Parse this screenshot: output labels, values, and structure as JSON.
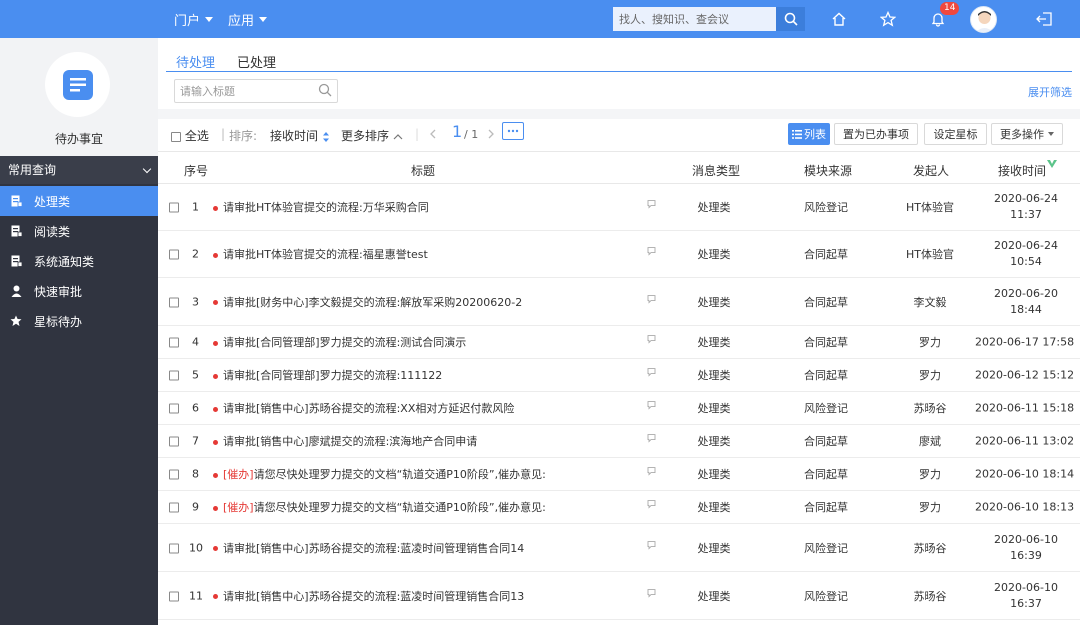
{
  "topbar": {
    "nav": [
      {
        "label": "门户"
      },
      {
        "label": "应用"
      }
    ],
    "search_placeholder": "找人、搜知识、查会议",
    "notification_count": "14"
  },
  "sidebar": {
    "title": "待办事宜",
    "group_label": "常用查询",
    "items": [
      {
        "label": "处理类",
        "icon": "document-icon",
        "active": true
      },
      {
        "label": "阅读类",
        "icon": "read-icon",
        "active": false
      },
      {
        "label": "系统通知类",
        "icon": "notice-icon",
        "active": false
      },
      {
        "label": "快速审批",
        "icon": "user-icon",
        "active": false
      },
      {
        "label": "星标待办",
        "icon": "star-icon",
        "active": false
      }
    ]
  },
  "main": {
    "tabs": [
      {
        "label": "待处理"
      },
      {
        "label": "已处理"
      }
    ],
    "filter_placeholder": "请输入标题",
    "expand_filter": "展开筛选",
    "toolbar": {
      "select_all": "全选",
      "sort_label": "排序:",
      "sort_field": "接收时间",
      "more_sort": "更多排序",
      "current_page": "1",
      "total_pages": "/ 1",
      "list_view": "列表",
      "mark_done": "置为已办事项",
      "set_star": "设定星标",
      "more_actions": "更多操作"
    },
    "columns": {
      "no": "序号",
      "title": "标题",
      "type": "消息类型",
      "module": "模块来源",
      "sender": "发起人",
      "time": "接收时间"
    },
    "rows": [
      {
        "no": "1",
        "prefix": "",
        "title": "请审批HT体验官提交的流程:万华采购合同",
        "type": "处理类",
        "module": "风险登记",
        "sender": "HT体验官",
        "date": "2020-06-24",
        "time": "11:37"
      },
      {
        "no": "2",
        "prefix": "",
        "title": "请审批HT体验官提交的流程:福星惠誉test",
        "type": "处理类",
        "module": "合同起草",
        "sender": "HT体验官",
        "date": "2020-06-24",
        "time": "10:54"
      },
      {
        "no": "3",
        "prefix": "",
        "title": "请审批[财务中心]李文毅提交的流程:解放军采购20200620-2",
        "type": "处理类",
        "module": "合同起草",
        "sender": "李文毅",
        "date": "2020-06-20",
        "time": "18:44"
      },
      {
        "no": "4",
        "prefix": "",
        "title": "请审批[合同管理部]罗力提交的流程:测试合同演示",
        "type": "处理类",
        "module": "合同起草",
        "sender": "罗力",
        "date": "2020-06-17 17:58",
        "time": ""
      },
      {
        "no": "5",
        "prefix": "",
        "title": "请审批[合同管理部]罗力提交的流程:111122",
        "type": "处理类",
        "module": "合同起草",
        "sender": "罗力",
        "date": "2020-06-12 15:12",
        "time": ""
      },
      {
        "no": "6",
        "prefix": "",
        "title": "请审批[销售中心]苏旸谷提交的流程:XX相对方延迟付款风险",
        "type": "处理类",
        "module": "风险登记",
        "sender": "苏旸谷",
        "date": "2020-06-11 15:18",
        "time": ""
      },
      {
        "no": "7",
        "prefix": "",
        "title": "请审批[销售中心]廖斌提交的流程:滨海地产合同申请",
        "type": "处理类",
        "module": "合同起草",
        "sender": "廖斌",
        "date": "2020-06-11 13:02",
        "time": ""
      },
      {
        "no": "8",
        "prefix": "[催办]",
        "title": "请您尽快处理罗力提交的文档“轨道交通P10阶段”,催办意见:",
        "type": "处理类",
        "module": "合同起草",
        "sender": "罗力",
        "date": "2020-06-10 18:14",
        "time": ""
      },
      {
        "no": "9",
        "prefix": "[催办]",
        "title": "请您尽快处理罗力提交的文档“轨道交通P10阶段”,催办意见:",
        "type": "处理类",
        "module": "合同起草",
        "sender": "罗力",
        "date": "2020-06-10 18:13",
        "time": ""
      },
      {
        "no": "10",
        "prefix": "",
        "title": "请审批[销售中心]苏旸谷提交的流程:蓝凌时间管理销售合同14",
        "type": "处理类",
        "module": "风险登记",
        "sender": "苏旸谷",
        "date": "2020-06-10",
        "time": "16:39"
      },
      {
        "no": "11",
        "prefix": "",
        "title": "请审批[销售中心]苏旸谷提交的流程:蓝凌时间管理销售合同13",
        "type": "处理类",
        "module": "风险登记",
        "sender": "苏旸谷",
        "date": "2020-06-10",
        "time": "16:37"
      }
    ]
  }
}
